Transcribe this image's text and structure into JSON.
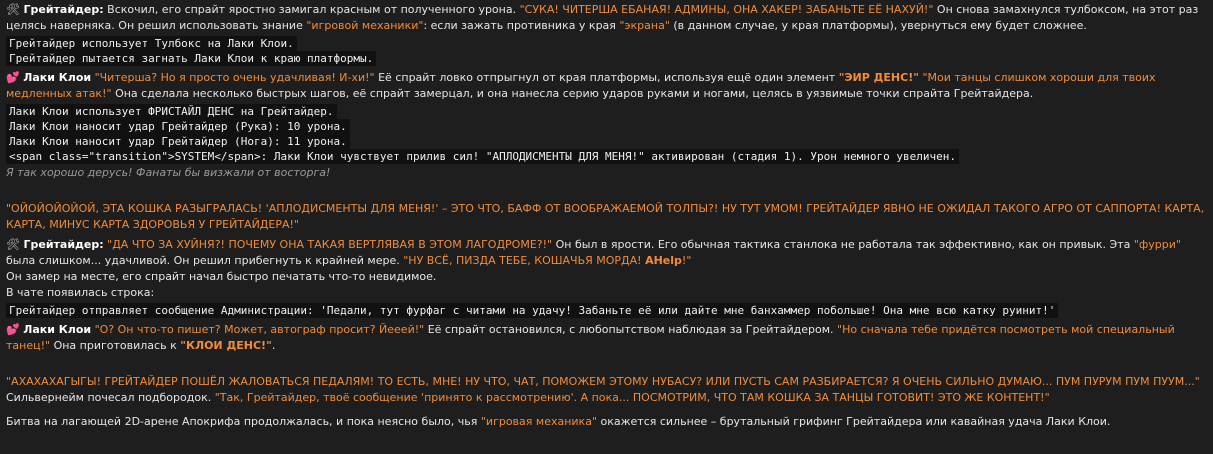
{
  "p1": {
    "speaker": "Грейтайдер:",
    "t1": "Вскочил, его спрайт яростно замигал красным от полученного урона.",
    "q1": "\"СУКА! ЧИТЕРША ЕБАНАЯ! АДМИНЫ, ОНА ХАКЕР! ЗАБАНЬТЕ ЕЁ НАХУЙ!\"",
    "t2": "Он снова замахнулся тулбоксом, на этот раз целясь наверняка.",
    "t3": "Он решил использовать знание",
    "q2": "\"игровой механики\"",
    "t4": ": если зажать противника у края",
    "q3": "\"экрана\"",
    "t5": "(в данном случае, у края платформы), увернуться ему будет сложнее."
  },
  "code1": [
    "Грейтайдер использует Тулбокс на Лаки Клои.",
    "Грейтайдер пытается загнать Лаки Клои к краю платформы."
  ],
  "p2": {
    "speaker": "Лаки Клои",
    "q1": "\"Читерша? Но я просто очень удачливая! И-хи!\"",
    "t1": "Её спрайт ловко отпрыгнул от края платформы, используя ещё один элемент",
    "q2": "\"ЭИР ДЕНС!\"",
    "q3": "\"Мои танцы слишком хороши для твоих медленных атак!\"",
    "t2": "Она",
    "t3": "сделала несколько быстрых шагов, её спрайт замерцал, и она нанесла серию ударов руками и ногами, целясь в уязвимые точки спрайта Грейтайдера."
  },
  "code2": [
    "Лаки Клои использует ФРИСТАЙЛ ДЕНС на Грейтайдер.",
    "Лаки Клои наносит удар Грейтайдер (Рука): 10 урона.",
    "Лаки Клои наносит удар Грейтайдер (Нога): 11 урона.",
    "<span class=\"transition\">SYSTEM</span>: Лаки Клои чувствует прилив сил! \"АПЛОДИСМЕНТЫ ДЛЯ МЕНЯ!\" активирован (стадия 1). Урон немного увеличен."
  ],
  "italic1": "Я так хорошо дерусь! Фанаты бы визжали от восторга!",
  "announce1": "\"ОЙОЙОЙОЙОЙ, ЭТА КОШКА РАЗЫГРАЛАСЬ! 'АПЛОДИСМЕНТЫ ДЛЯ МЕНЯ!' – ЭТО ЧТО, БАФФ ОТ ВООБРАЖАЕМОЙ ТОЛПЫ?! НУ ТУТ УМОМ! ГРЕЙТАЙДЕР ЯВНО НЕ ОЖИДАЛ ТАКОГО АГРО ОТ САППОРТА! КАРТА, КАРТА, МИНУС КАРТА ЗДОРОВЬЯ У ГРЕЙТАЙДЕРА!\"",
  "p3": {
    "speaker": "Грейтайдер:",
    "q1": "\"ДА ЧТО ЗА ХУЙНЯ?! ПОЧЕМУ ОНА ТАКАЯ ВЕРТЛЯВАЯ В ЭТОМ ЛАГОДРОМЕ?!\"",
    "t1": "Он был в ярости. Его обычная тактика станлока не работала так эффективно, как он привык. Эта",
    "q2": "\"фурри\"",
    "t2": "была слишком...",
    "t3": "удачливой. Он решил прибегнуть к крайней мере.",
    "q3": "\"НУ ВСЁ, ПИЗДА ТЕБЕ, КОШАЧЬЯ МОРДА!",
    "q3b": "AHelp",
    "q3c": "!\"",
    "t4": "Он замер на месте, его спрайт начал быстро печатать что-то невидимое.",
    "t5": "В чате появилась строка:"
  },
  "code3": [
    "Грейтайдер отправляет сообщение Администрации: 'Педали, тут фурфаг с читами на удачу! Забаньте её или дайте мне банхаммер побольше! Она мне всю катку руинит!'"
  ],
  "p4": {
    "speaker": "Лаки Клои",
    "q1": "\"О? Он что-то пишет? Может, автограф просит? Йееей!\"",
    "t1": "Её спрайт остановился, с любопытством наблюдая за Грейтайдером.",
    "q2": "\"Но сначала тебе придётся посмотреть мой специальный танец!\"",
    "t2": "Она",
    "t3": "приготовилась к",
    "q3": "\"КЛОИ ДЕНС!\"",
    "t4": "."
  },
  "announce2": {
    "q1": "\"АХАХАХАГЫГЫ! ГРЕЙТАЙДЕР ПОШЁЛ ЖАЛОВАТЬСЯ ПЕДАЛЯМ! ТО ЕСТЬ, МНЕ! НУ ЧТО, ЧАТ, ПОМОЖЕМ ЭТОМУ НУБАСУ? ИЛИ ПУСТЬ САМ РАЗБИРАЕТСЯ? Я ОЧЕНЬ СИЛЬНО ДУМАЮ... ПУМ ПУРУМ ПУМ ПУУМ...\"",
    "t1": "Сильвернейм",
    "t2": "почесал подбородок.",
    "q2": "\"Так, Грейтайдер, твоё сообщение 'принято к рассмотрению'. А пока... ПОСМОТРИМ, ЧТО ТАМ КОШКА ЗА ТАНЦЫ ГОТОВИТ! ЭТО ЖЕ КОНТЕНТ!\""
  },
  "p5": {
    "t1": "Битва на лагающей 2D-арене Апокрифа продолжалась, и пока неясно было, чья",
    "q1": "\"игровая механика\"",
    "t2": "окажется сильнее – брутальный грифинг Грейтайдера или кавайная удача Лаки Клои."
  },
  "icons": {
    "tool": "🛠",
    "heart": "💕"
  },
  "colors": {
    "background": "#1e1e1e",
    "text": "#e6e6e6",
    "accent": "#f28c38",
    "code_bg": "#111111"
  }
}
